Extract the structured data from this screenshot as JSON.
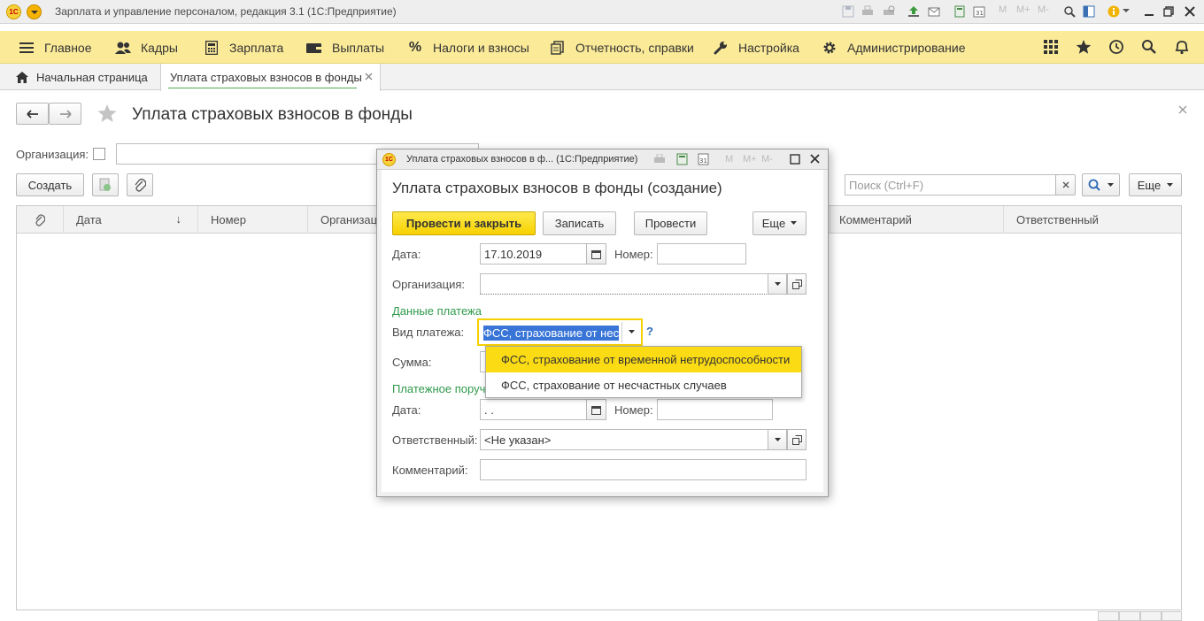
{
  "app": {
    "title": "Зарплата и управление персоналом, редакция 3.1  (1С:Предприятие)",
    "title_icons": [
      "logo-1c-icon",
      "menu-dropdown-icon",
      "save-icon",
      "print-icon",
      "print-preview-icon",
      "upload-icon",
      "mail-icon",
      "calculator-icon",
      "calendar-icon",
      "zoom-icon",
      "panels-icon",
      "info-icon",
      "minimize-icon",
      "restore-icon",
      "close-icon"
    ],
    "memory_buttons": [
      "M",
      "M+",
      "M-"
    ]
  },
  "menu": {
    "items": [
      {
        "label": "Главное",
        "icon": "hamburger-icon"
      },
      {
        "label": "Кадры",
        "icon": "people-icon"
      },
      {
        "label": "Зарплата",
        "icon": "calculator-icon"
      },
      {
        "label": "Выплаты",
        "icon": "wallet-icon"
      },
      {
        "label": "Налоги и взносы",
        "icon": "percent-icon"
      },
      {
        "label": "Отчетность, справки",
        "icon": "reports-icon"
      },
      {
        "label": "Настройка",
        "icon": "wrench-icon"
      },
      {
        "label": "Администрирование",
        "icon": "gear-icon"
      }
    ],
    "right_icons": [
      "apps-grid-icon",
      "star-icon",
      "history-icon",
      "search-icon",
      "bell-icon"
    ]
  },
  "tabs": {
    "home": "Начальная страница",
    "active": "Уплата страховых взносов в фонды"
  },
  "list_form": {
    "title": "Уплата страховых взносов в фонды",
    "org_label": "Организация:",
    "create_button": "Создать",
    "search_placeholder": "Поиск (Ctrl+F)",
    "more_button": "Еще",
    "columns": [
      "Дата",
      "Номер",
      "Организация",
      "Комментарий",
      "Ответственный"
    ]
  },
  "dialog": {
    "window_title": "Уплата страховых взносов в ф...  (1С:Предприятие)",
    "heading": "Уплата страховых взносов в фонды (создание)",
    "buttons": {
      "post_close": "Провести и закрыть",
      "save": "Записать",
      "post": "Провести",
      "more": "Еще"
    },
    "date_label": "Дата:",
    "date_value": "17.10.2019",
    "number_label": "Номер:",
    "number_value": "",
    "org_label": "Организация:",
    "org_value": "",
    "payment_section": "Данные платежа",
    "payment_type_label": "Вид платежа:",
    "payment_type_value": "ФСС, страхование от нес",
    "help_mark": "?",
    "sum_label": "Сумма:",
    "order_section": "Платежное поручение",
    "order_date_label": "Дата:",
    "order_date_value": " .  .",
    "order_number_label": "Номер:",
    "responsible_label": "Ответственный:",
    "responsible_value": "<Не указан>",
    "comment_label": "Комментарий:",
    "comment_value": ""
  },
  "dropdown": {
    "options": [
      {
        "label": "ФСС, страхование от временной нетрудоспособности",
        "highlighted": true
      },
      {
        "label": "ФСС, страхование от несчастных случаев",
        "highlighted": false
      }
    ]
  },
  "colors": {
    "menu_bg": "#fbeb99",
    "accent_yellow": "#f6d100",
    "section_green": "#2f9a4c",
    "selection_blue": "#3875d7"
  }
}
